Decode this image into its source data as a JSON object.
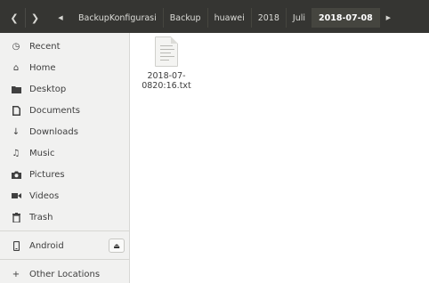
{
  "window": {
    "back_icon": "chevron-left-icon",
    "forward_icon": "chevron-right-icon"
  },
  "breadcrumb": {
    "items": [
      "BackupKonfigurasi",
      "Backup",
      "huawei",
      "2018",
      "Juli",
      "2018-07-08"
    ],
    "active_index": 5
  },
  "sidebar": {
    "items": [
      {
        "label": "Recent",
        "icon": "clock-icon"
      },
      {
        "label": "Home",
        "icon": "home-icon"
      },
      {
        "label": "Desktop",
        "icon": "folder-icon"
      },
      {
        "label": "Documents",
        "icon": "document-icon"
      },
      {
        "label": "Downloads",
        "icon": "download-icon"
      },
      {
        "label": "Music",
        "icon": "music-icon"
      },
      {
        "label": "Pictures",
        "icon": "camera-icon"
      },
      {
        "label": "Videos",
        "icon": "video-icon"
      },
      {
        "label": "Trash",
        "icon": "trash-icon"
      }
    ],
    "devices": [
      {
        "label": "Android",
        "icon": "phone-icon",
        "eject_icon": "eject-icon"
      }
    ],
    "other": {
      "label": "Other Locations",
      "icon": "plus-icon"
    }
  },
  "files": [
    {
      "name": "2018-07-0820:16.txt",
      "display_lines": [
        "2018-07-",
        "0820:16.txt"
      ],
      "icon": "text-file-icon"
    }
  ]
}
